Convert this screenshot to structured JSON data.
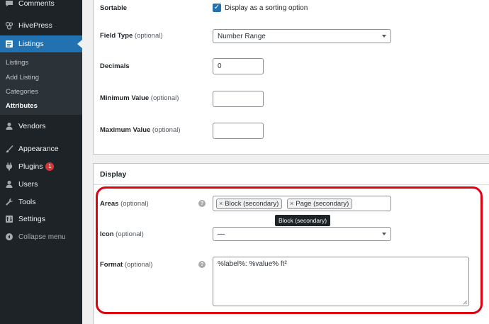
{
  "sidebar": {
    "items": [
      {
        "label": "Comments",
        "icon": "comment-icon"
      },
      {
        "label": "HivePress",
        "icon": "hivepress-icon"
      },
      {
        "label": "Listings",
        "icon": "listings-icon",
        "active": true
      },
      {
        "label": "Vendors",
        "icon": "user-icon"
      },
      {
        "label": "Appearance",
        "icon": "brush-icon"
      },
      {
        "label": "Plugins",
        "icon": "plugin-icon",
        "badge": "1"
      },
      {
        "label": "Users",
        "icon": "users-icon"
      },
      {
        "label": "Tools",
        "icon": "wrench-icon"
      },
      {
        "label": "Settings",
        "icon": "settings-icon"
      },
      {
        "label": "Collapse menu",
        "icon": "collapse-icon"
      }
    ],
    "submenu": [
      "Listings",
      "Add Listing",
      "Categories",
      "Attributes"
    ],
    "current_submenu": "Attributes"
  },
  "form": {
    "sortable": {
      "label": "Sortable",
      "checkbox_label": "Display as a sorting option",
      "checked": true
    },
    "field_type": {
      "label": "Field Type",
      "optional": "(optional)",
      "value": "Number Range"
    },
    "decimals": {
      "label": "Decimals",
      "value": "0"
    },
    "min_value": {
      "label": "Minimum Value",
      "optional": "(optional)",
      "value": ""
    },
    "max_value": {
      "label": "Maximum Value",
      "optional": "(optional)",
      "value": ""
    }
  },
  "display": {
    "title": "Display",
    "areas": {
      "label": "Areas",
      "optional": "(optional)",
      "tags": [
        "Block (secondary)",
        "Page (secondary)"
      ],
      "tooltip": "Block (secondary)"
    },
    "icon": {
      "label": "Icon",
      "optional": "(optional)",
      "value": "—"
    },
    "format": {
      "label": "Format",
      "optional": "(optional)",
      "value": "%label%: %value% ft²"
    }
  },
  "help_glyph": "?",
  "colors": {
    "sidebar_bg": "#1d2327",
    "accent": "#2271b1",
    "highlight": "#e10010",
    "badge": "#d63638"
  }
}
